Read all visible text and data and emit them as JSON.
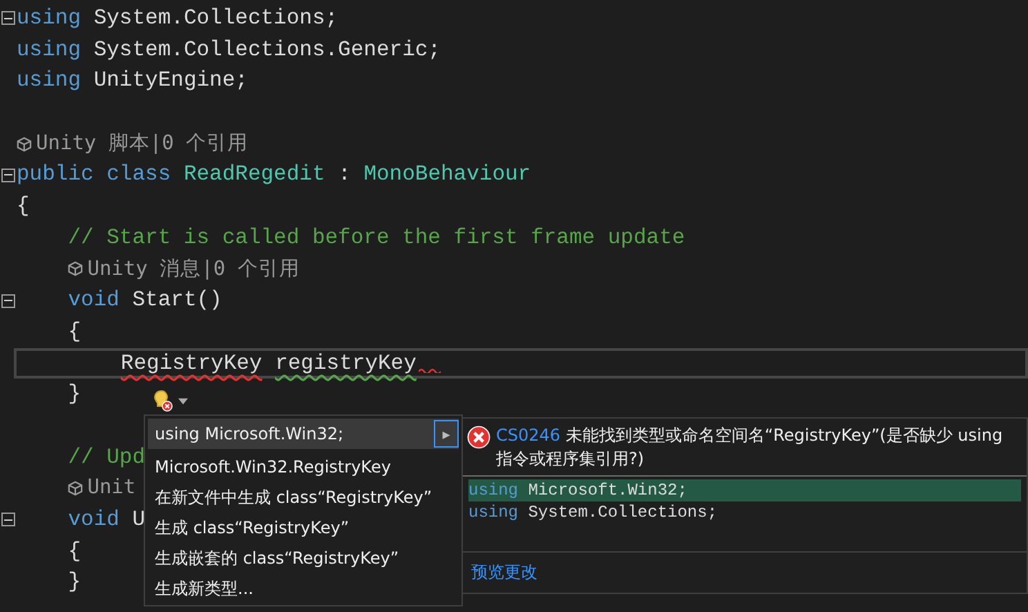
{
  "code_lines": [
    {
      "fold": true,
      "current": false,
      "segments": [
        {
          "kind": "keyword",
          "t": "using"
        },
        {
          "kind": "plain",
          "t": " System.Collections;"
        }
      ]
    },
    {
      "fold": false,
      "current": false,
      "segments": [
        {
          "kind": "keyword",
          "t": "using"
        },
        {
          "kind": "plain",
          "t": " System.Collections.Generic;"
        }
      ]
    },
    {
      "fold": false,
      "current": false,
      "segments": [
        {
          "kind": "keyword",
          "t": "using"
        },
        {
          "kind": "plain",
          "t": " UnityEngine;"
        }
      ]
    },
    {
      "fold": false,
      "current": false
    },
    {
      "fold": false,
      "current": false,
      "segments": [
        {
          "kind": "lens",
          "t": "Unity 脚本|0 个引用"
        }
      ]
    },
    {
      "fold": true,
      "current": false,
      "segments": [
        {
          "kind": "keyword",
          "t": "public class"
        },
        {
          "kind": "type",
          "t": " ReadRegedit"
        },
        {
          "kind": "plain",
          "t": " : "
        },
        {
          "kind": "type",
          "t": "MonoBehaviour"
        }
      ]
    },
    {
      "fold": false,
      "current": false,
      "segments": [
        {
          "kind": "plain",
          "t": "{"
        }
      ]
    },
    {
      "fold": false,
      "current": false,
      "segments": [
        {
          "kind": "comment",
          "t": "    // Start is called before the first frame update"
        }
      ]
    },
    {
      "fold": false,
      "current": false,
      "segments": [
        {
          "kind": "lens",
          "t": "    Unity 消息|0 个引用"
        }
      ]
    },
    {
      "fold": true,
      "current": false,
      "segments": [
        {
          "kind": "keyword",
          "t": "    void"
        },
        {
          "kind": "plain",
          "t": " Start()"
        }
      ]
    },
    {
      "fold": false,
      "current": false,
      "segments": [
        {
          "kind": "plain",
          "t": "    {"
        }
      ]
    },
    {
      "fold": false,
      "current": true,
      "trailing_error": true,
      "segments": [
        {
          "kind": "plain",
          "t": "        RegistryKey",
          "error": true,
          "warning": false
        },
        {
          "kind": "plain",
          "t": " registryKey",
          "error": false,
          "warning": true
        }
      ]
    },
    {
      "fold": false,
      "current": false,
      "segments": [
        {
          "kind": "plain",
          "t": "    }"
        }
      ]
    },
    {
      "fold": false,
      "current": false
    },
    {
      "fold": false,
      "current": false,
      "segments": [
        {
          "kind": "comment",
          "t": "    // Upd"
        }
      ]
    },
    {
      "fold": false,
      "current": false,
      "segments": [
        {
          "kind": "lens",
          "t": "    Unit"
        }
      ]
    },
    {
      "fold": true,
      "current": false,
      "segments": [
        {
          "kind": "keyword",
          "t": "    void"
        },
        {
          "kind": "plain",
          "t": " U"
        }
      ]
    },
    {
      "fold": false,
      "current": false,
      "segments": [
        {
          "kind": "plain",
          "t": "    {"
        }
      ]
    },
    {
      "fold": false,
      "current": false,
      "segments": [
        {
          "kind": "plain",
          "t": "    }"
        }
      ]
    }
  ],
  "quick_actions": {
    "items": [
      {
        "label": "using Microsoft.Win32;",
        "selected": true
      },
      {
        "label": "Microsoft.Win32.RegistryKey",
        "selected": false
      },
      {
        "label": "在新文件中生成 class“RegistryKey”",
        "selected": false
      },
      {
        "label": "生成 class“RegistryKey”",
        "selected": false
      },
      {
        "label": "生成嵌套的 class“RegistryKey”",
        "selected": false
      },
      {
        "label": "生成新类型...",
        "selected": false
      }
    ],
    "submenu_arrow": "▸",
    "preview": {
      "error_code": "CS0246",
      "message": "未能找到类型或命名空间名“RegistryKey”(是否缺少 using 指令或程序集引用?)",
      "lines": [
        {
          "highlighted": true,
          "segments": [
            {
              "kind": "keyword",
              "t": "using"
            },
            {
              "kind": "plain",
              "t": " Microsoft.Win32;"
            }
          ]
        },
        {
          "highlighted": false,
          "segments": [
            {
              "kind": "keyword",
              "t": "using"
            },
            {
              "kind": "plain",
              "t": " System.Collections;"
            }
          ]
        }
      ],
      "link": "预览更改"
    }
  }
}
